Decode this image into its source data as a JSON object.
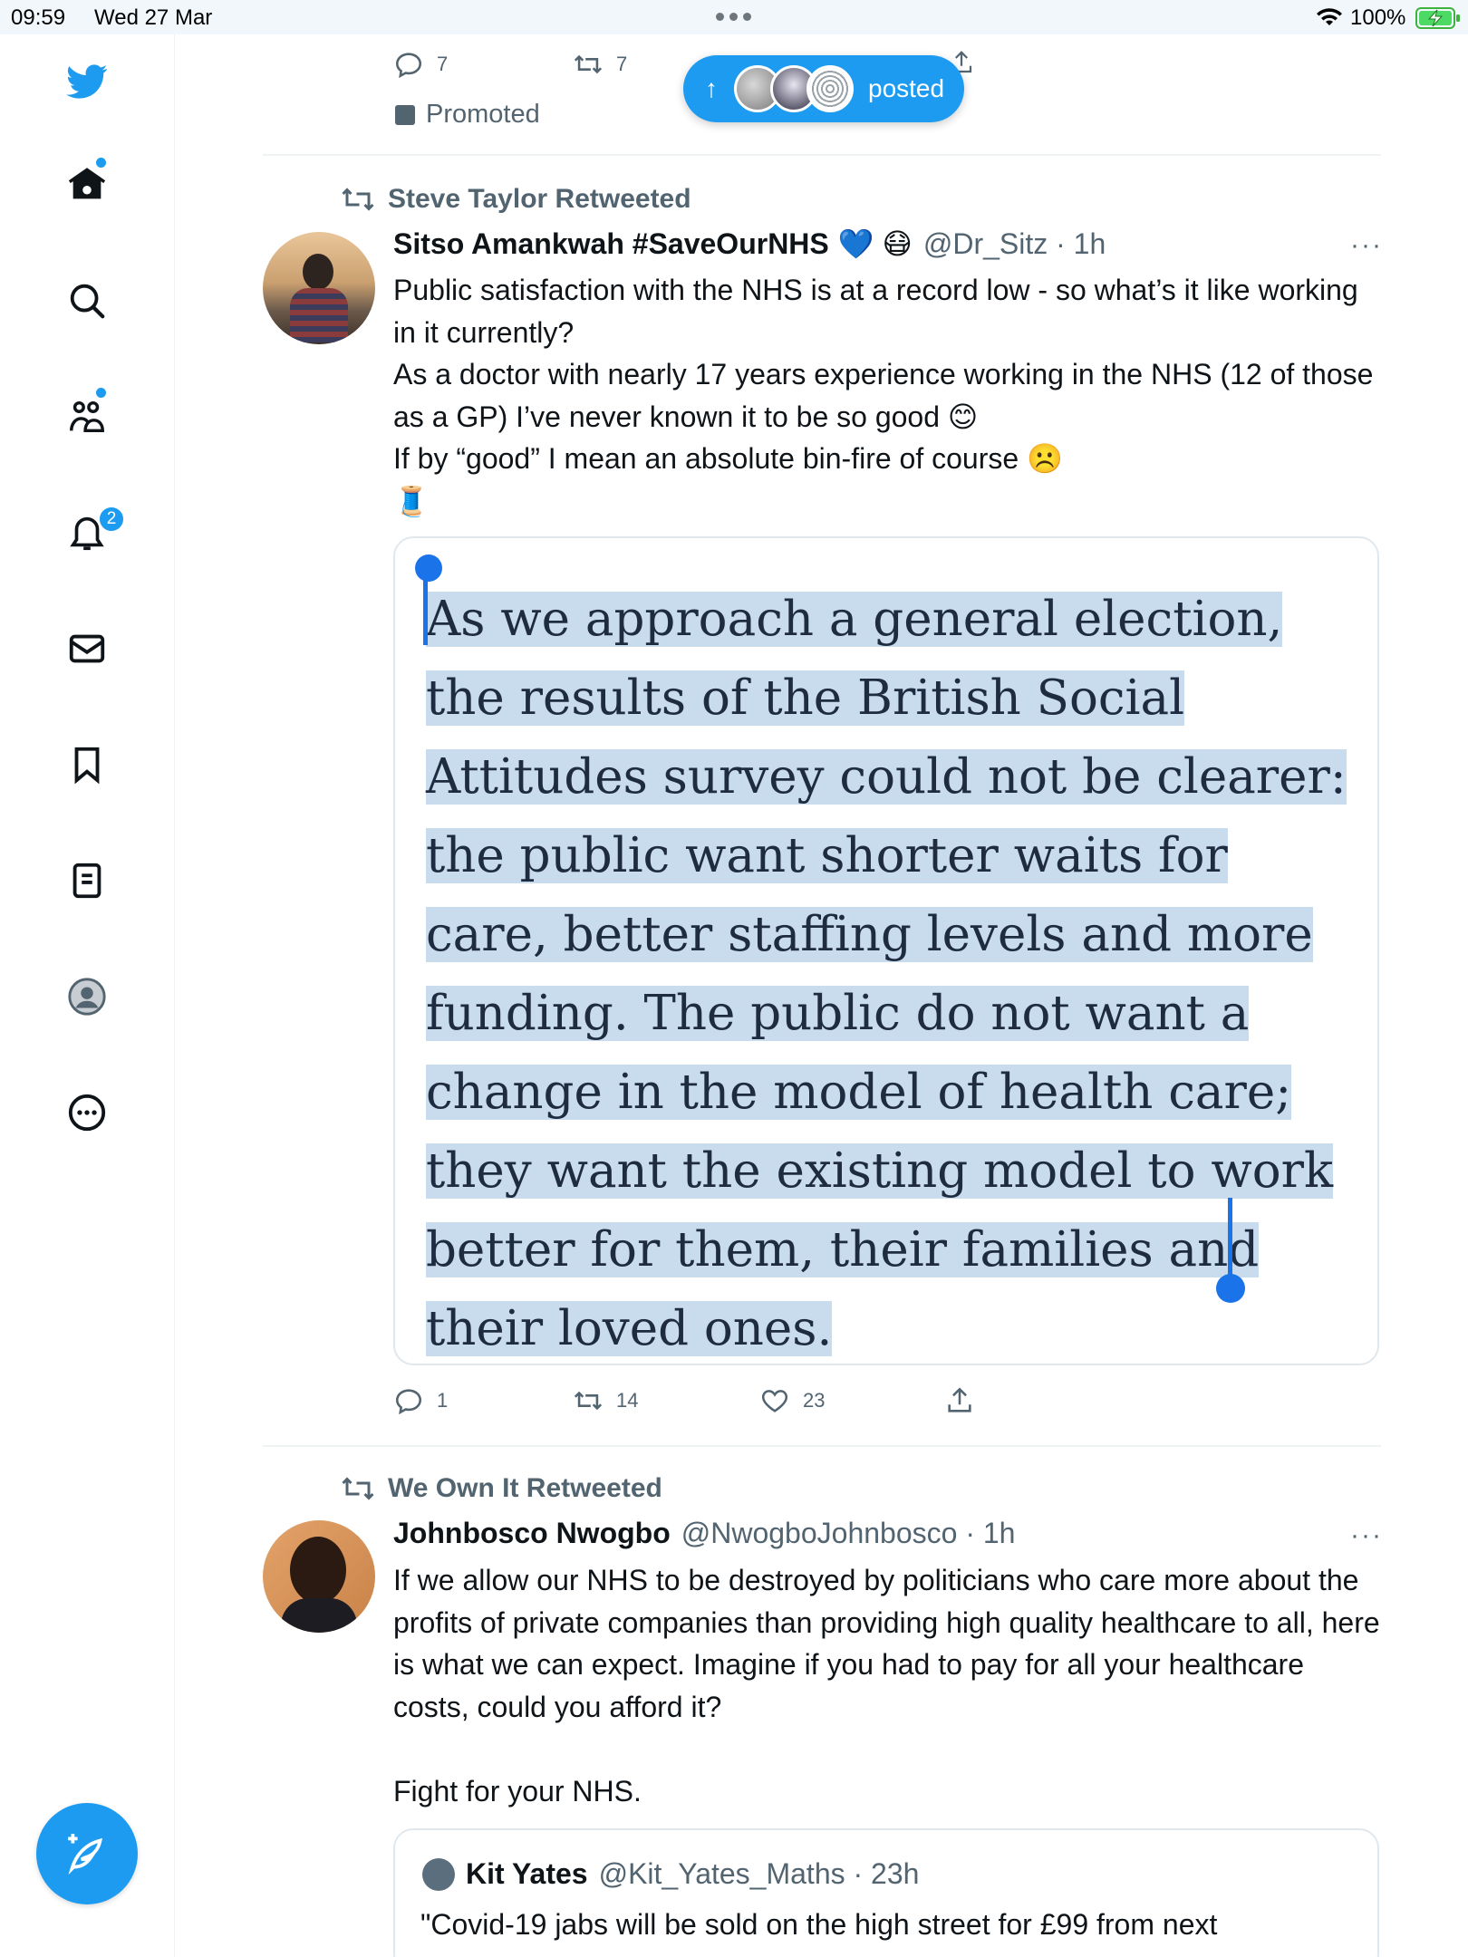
{
  "status_bar": {
    "time": "09:59",
    "date": "Wed 27 Mar",
    "battery": "100%"
  },
  "sidebar": {
    "items": [
      {
        "icon": "twitter-bird-icon"
      },
      {
        "icon": "home-icon"
      },
      {
        "icon": "search-icon"
      },
      {
        "icon": "communities-icon"
      },
      {
        "icon": "notifications-icon"
      },
      {
        "icon": "messages-icon"
      },
      {
        "icon": "bookmarks-icon"
      },
      {
        "icon": "lists-icon"
      },
      {
        "icon": "profile-icon"
      },
      {
        "icon": "more-icon"
      }
    ],
    "notification_badge": "2",
    "compose_icon": "compose-icon"
  },
  "top_tweet": {
    "reply_count": "7",
    "retweet_count": "7",
    "promoted_label": "Promoted"
  },
  "new_posts_pill": {
    "arrow": "↑",
    "label": "posted"
  },
  "tweet1": {
    "retweeted_by": "Steve Taylor Retweeted",
    "name": "Sitso Amankwah #SaveOurNHS",
    "emoji_after_name": "💙 😷",
    "handle_time": "@Dr_Sitz · 1h",
    "more": "···",
    "text": "Public satisfaction with the NHS is at a record low - so what’s it like working in it currently?\nAs a doctor with nearly 17 years experience working in the NHS (12 of those as a GP) I’ve never known it to be so good 😊\nIf by “good” I mean an absolute bin-fire of course ☹️\n🧵",
    "image_text": "As we approach a general election, the results of the British Social Attitudes survey could not be clearer: the public want shorter waits for care, better staffing levels and more funding. The public do not want a change in the model of health care; they want the existing model to work better for them, their families and their loved ones.",
    "reply_count": "1",
    "retweet_count": "14",
    "like_count": "23"
  },
  "tweet2": {
    "retweeted_by": "We Own It Retweeted",
    "name": "Johnbosco Nwogbo",
    "handle_time": "@NwogboJohnbosco · 1h",
    "more": "···",
    "text": "If we allow our NHS to be destroyed by politicians who care more about the profits of private companies than providing high quality healthcare to all, here is what we can expect. Imagine if you had to pay for all your healthcare costs, could you afford it?\n\nFight for your NHS.",
    "quoted": {
      "name": "Kit Yates",
      "handle_time": "@Kit_Yates_Maths · 23h",
      "text": "\"Covid-19 jabs will be sold on the high street for £99 from next"
    }
  },
  "colors": {
    "accent": "#1d9bf0",
    "selection": "#c8dcee",
    "secondary_text": "#536471"
  }
}
